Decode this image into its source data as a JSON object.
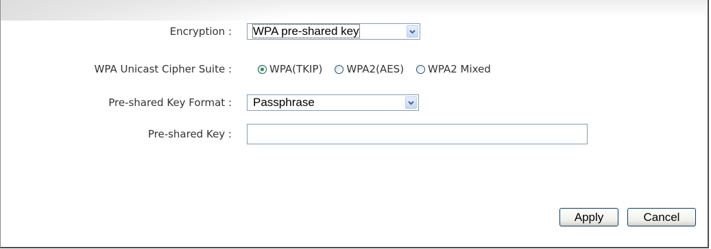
{
  "form": {
    "encryption": {
      "label": "Encryption :",
      "selected": "WPA pre-shared key"
    },
    "cipher_suite": {
      "label": "WPA Unicast Cipher Suite :",
      "options": [
        {
          "label": "WPA(TKIP)",
          "checked": true
        },
        {
          "label": "WPA2(AES)",
          "checked": false
        },
        {
          "label": "WPA2 Mixed",
          "checked": false
        }
      ]
    },
    "key_format": {
      "label": "Pre-shared Key Format :",
      "selected": "Passphrase"
    },
    "preshared_key": {
      "label": "Pre-shared Key :",
      "value": ""
    }
  },
  "buttons": {
    "apply": "Apply",
    "cancel": "Cancel"
  },
  "icons": {
    "dropdown": "chevron-down-icon"
  },
  "colors": {
    "radio_selected": "#21a121",
    "dropdown_arrow": "#4d6185"
  }
}
